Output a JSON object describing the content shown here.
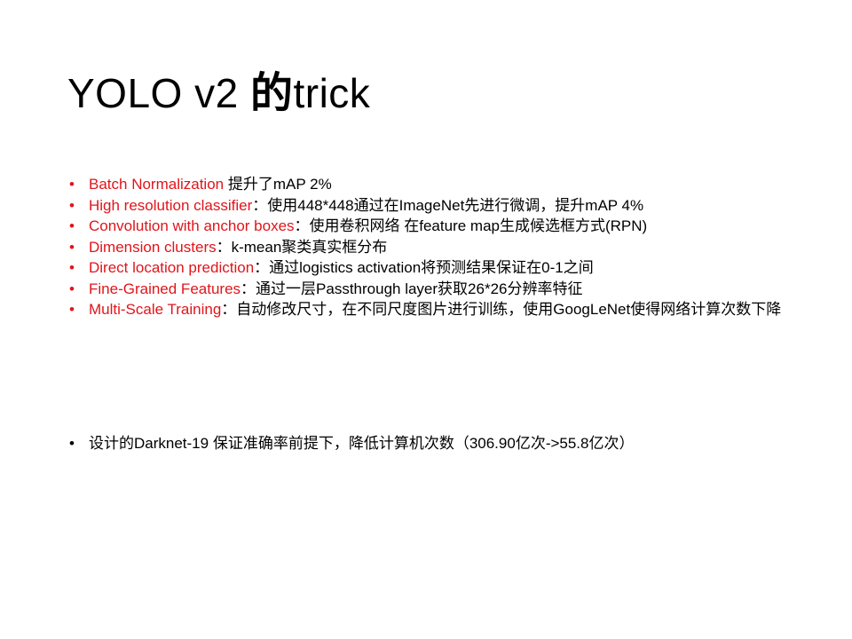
{
  "slide": {
    "title_latin": "YOLO v2 ",
    "title_cjk": "的",
    "title_suffix": "trick"
  },
  "tricks": [
    {
      "term": "Batch Normalization",
      "sep": " ",
      "desc": "提升了mAP 2%"
    },
    {
      "term": "High resolution classifier",
      "sep": "：",
      "desc": "使用448*448通过在ImageNet先进行微调，提升mAP 4%"
    },
    {
      "term": "Convolution with anchor boxes",
      "sep": "：",
      "desc": "使用卷积网络 在feature map生成候选框方式(RPN)"
    },
    {
      "term": "Dimension clusters",
      "sep": "：",
      "desc": "k-mean聚类真实框分布"
    },
    {
      "term": "Direct location prediction",
      "sep": "：",
      "desc": "通过logistics activation将预测结果保证在0-1之间"
    },
    {
      "term": "Fine-Grained Features",
      "sep": "：",
      "desc": "通过一层Passthrough layer获取26*26分辨率特征"
    },
    {
      "term": "Multi-Scale Training",
      "sep": "：",
      "desc": "自动修改尺寸，在不同尺度图片进行训练，使用GoogLeNet使得网络计算次数下降"
    }
  ],
  "summary": {
    "text": "设计的Darknet-19 保证准确率前提下，降低计算机次数（306.90亿次->55.8亿次）"
  },
  "colors": {
    "accent": "#e0151b",
    "text": "#000000",
    "background": "#ffffff"
  }
}
